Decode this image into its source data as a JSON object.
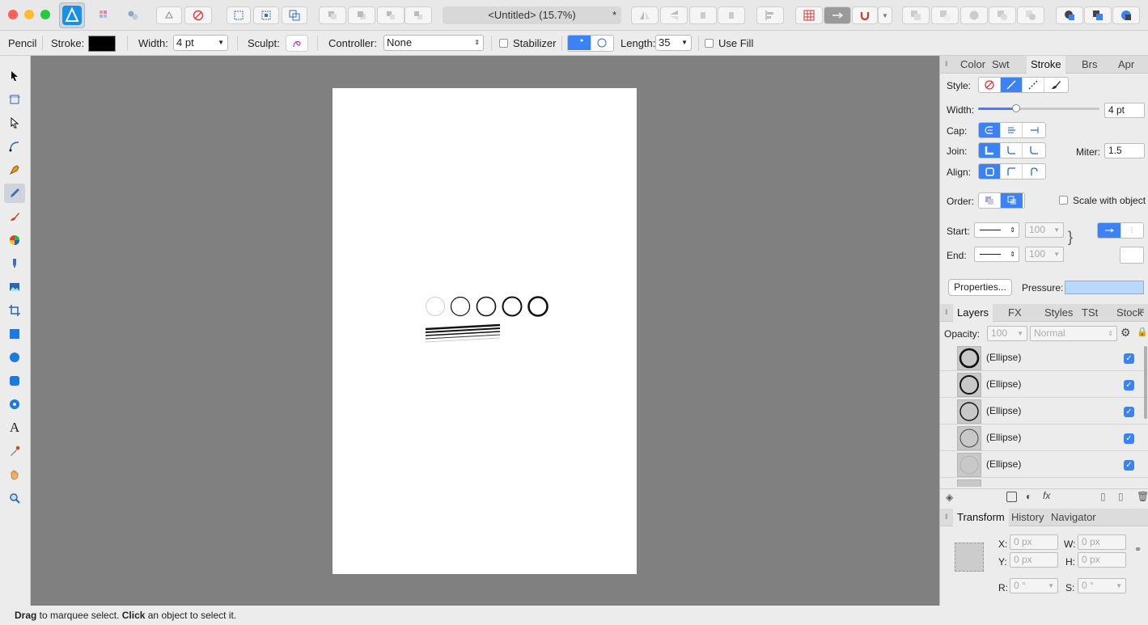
{
  "window": {
    "title": "<Untitled> (15.7%)",
    "modified_marker": "*"
  },
  "context_toolbar": {
    "tool_name": "Pencil",
    "stroke_label": "Stroke:",
    "stroke_color": "#000000",
    "width_label": "Width:",
    "width_value": "4 pt",
    "sculpt_label": "Sculpt:",
    "controller_label": "Controller:",
    "controller_value": "None",
    "stabilizer_label": "Stabilizer",
    "length_label": "Length:",
    "length_value": "35",
    "use_fill_label": "Use Fill"
  },
  "tools": [
    "move-tool",
    "artboard-tool",
    "node-tool",
    "corner-tool",
    "pen-tool",
    "pencil-tool",
    "vector-brush-tool",
    "fill-tool",
    "transparency-tool",
    "place-image-tool",
    "crop-tool",
    "rectangle-tool",
    "ellipse-tool",
    "rounded-rectangle-tool",
    "shape-tool",
    "text-tool",
    "color-picker-tool",
    "view-tool",
    "zoom-tool"
  ],
  "stroke_panel": {
    "tabs": [
      "Color",
      "Swt",
      "Stroke",
      "Brs",
      "Apr"
    ],
    "active_tab": "Stroke",
    "style_label": "Style:",
    "width_label": "Width:",
    "width_value": "4 pt",
    "width_slider_fraction": 0.31,
    "cap_label": "Cap:",
    "join_label": "Join:",
    "miter_label": "Miter:",
    "miter_value": "1.5",
    "align_label": "Align:",
    "order_label": "Order:",
    "scale_label": "Scale with object",
    "start_label": "Start:",
    "end_label": "End:",
    "start_size": "100",
    "end_size": "100",
    "properties_button": "Properties...",
    "pressure_label": "Pressure:"
  },
  "layers_panel": {
    "tabs": [
      "Layers",
      "FX",
      "Styles",
      "TSt",
      "Stock"
    ],
    "active_tab": "Layers",
    "opacity_label": "Opacity:",
    "opacity_value": "100",
    "blend_mode": "Normal",
    "layers": [
      {
        "name": "(Ellipse)",
        "visible": true
      },
      {
        "name": "(Ellipse)",
        "visible": true
      },
      {
        "name": "(Ellipse)",
        "visible": true
      },
      {
        "name": "(Ellipse)",
        "visible": true
      },
      {
        "name": "(Ellipse)",
        "visible": true
      }
    ]
  },
  "transform_panel": {
    "tabs": [
      "Transform",
      "History",
      "Navigator"
    ],
    "active_tab": "Transform",
    "x_label": "X:",
    "x_value": "0 px",
    "y_label": "Y:",
    "y_value": "0 px",
    "w_label": "W:",
    "w_value": "0 px",
    "h_label": "H:",
    "h_value": "0 px",
    "r_label": "R:",
    "r_value": "0 °",
    "s_label": "S:",
    "s_value": "0 °"
  },
  "status_bar": {
    "drag_bold": "Drag",
    "drag_text": " to marquee select. ",
    "click_bold": "Click",
    "click_text": " an object to select it."
  },
  "colors": {
    "accent": "#3b82f6",
    "canvas": "#808080",
    "page": "#ffffff"
  }
}
